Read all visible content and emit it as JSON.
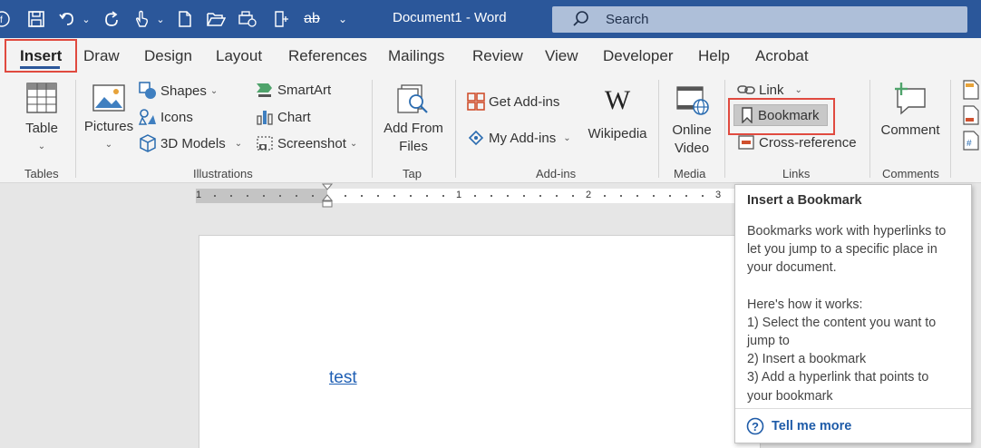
{
  "titlebar": {
    "doc_title": "Document1  -  Word",
    "search_label": "Search"
  },
  "tabs": [
    "Insert",
    "Draw",
    "Design",
    "Layout",
    "References",
    "Mailings",
    "Review",
    "View",
    "Developer",
    "Help",
    "Acrobat"
  ],
  "ribbon": {
    "tables": {
      "table": "Table",
      "group": "Tables"
    },
    "illustrations": {
      "pictures": "Pictures",
      "shapes": "Shapes",
      "icons": "Icons",
      "models": "3D Models",
      "smartart": "SmartArt",
      "chart": "Chart",
      "screenshot": "Screenshot",
      "group": "Illustrations"
    },
    "tap": {
      "add_from_files_1": "Add From",
      "add_from_files_2": "Files",
      "group": "Tap"
    },
    "addins": {
      "get": "Get Add-ins",
      "my": "My Add-ins",
      "wikipedia": "Wikipedia",
      "group": "Add-ins"
    },
    "media": {
      "online_1": "Online",
      "online_2": "Video",
      "group": "Media"
    },
    "links": {
      "link": "Link",
      "bookmark": "Bookmark",
      "crossref": "Cross-reference",
      "group": "Links"
    },
    "comments": {
      "comment": "Comment",
      "group": "Comments"
    }
  },
  "ruler": {
    "labels": [
      "1",
      "1",
      "2",
      "3"
    ]
  },
  "document": {
    "link_text": "test"
  },
  "tooltip": {
    "title": "Insert a Bookmark",
    "lines": [
      "Bookmarks work with hyperlinks to",
      "let you jump to a specific place in",
      "your document.",
      "",
      "Here's how it works:",
      "1) Select the content you want to",
      "jump to",
      "2) Insert a bookmark",
      "3) Add a hyperlink that points to",
      "your bookmark"
    ],
    "help": "Tell me more"
  },
  "colors": {
    "title_bar": "#2b579a",
    "highlight": "#e04a3f",
    "link": "#1f5fb4"
  }
}
